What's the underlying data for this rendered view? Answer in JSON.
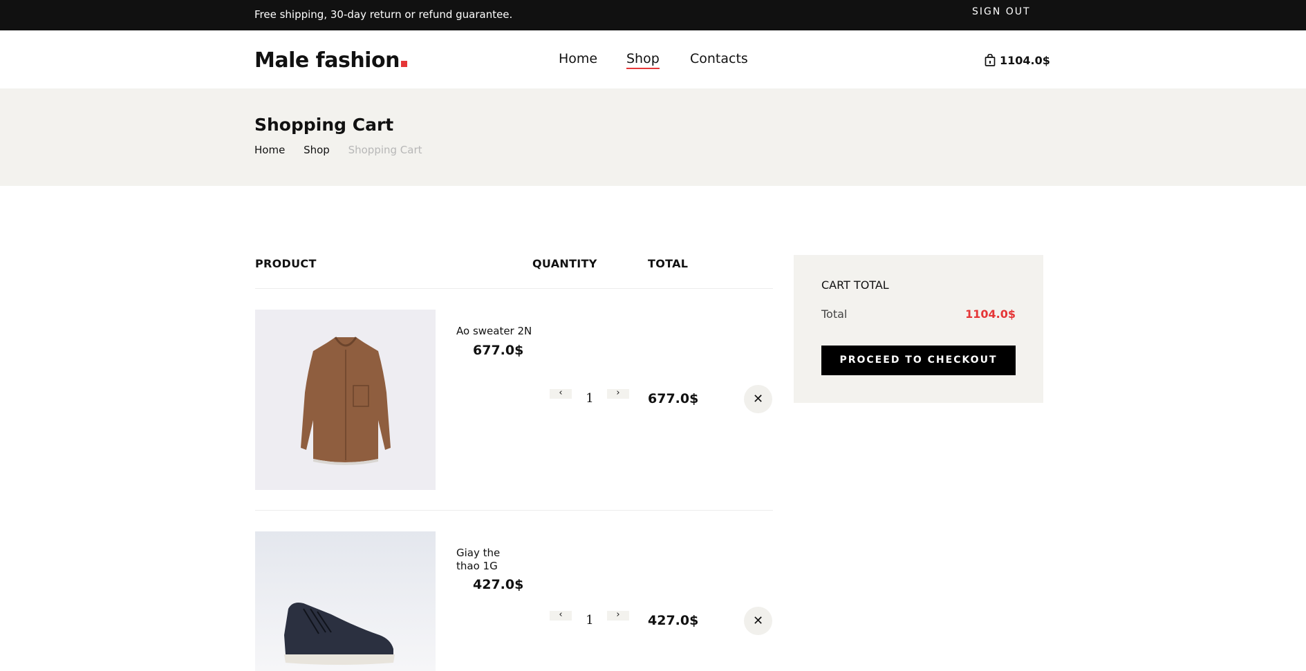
{
  "topbar": {
    "shipping_text": "Free shipping, 30-day return or refund guarantee.",
    "signout_label": "SIGN OUT"
  },
  "header": {
    "logo_text": "Male fashion",
    "nav": [
      {
        "label": "Home",
        "active": false
      },
      {
        "label": "Shop",
        "active": true
      },
      {
        "label": "Contacts",
        "active": false
      }
    ],
    "cart_total": "1104.0$",
    "cart_icon": "shopping-bag-icon"
  },
  "breadcrumb": {
    "title": "Shopping Cart",
    "items": [
      "Home",
      "Shop",
      "Shopping Cart"
    ]
  },
  "cart_table": {
    "headers": {
      "product": "PRODUCT",
      "quantity": "QUANTITY",
      "total": "TOTAL"
    },
    "decrement_icon": "chevron-left-icon",
    "increment_icon": "chevron-right-icon",
    "remove_icon": "close-icon",
    "rows": [
      {
        "name": "Ao sweater 2N",
        "price": "677.0$",
        "quantity": "1",
        "total": "677.0$",
        "image": "brown-shirt-image"
      },
      {
        "name": "Giay the thao 1G",
        "price": "427.0$",
        "quantity": "1",
        "total": "427.0$",
        "image": "navy-sneaker-image"
      }
    ]
  },
  "summary": {
    "title": "CART TOTAL",
    "total_label": "Total",
    "total_value": "1104.0$",
    "checkout_label": "PROCEED TO CHECKOUT"
  },
  "colors": {
    "accent": "#e53637",
    "topbar_bg": "#111111",
    "band_bg": "#f3f2ee"
  }
}
